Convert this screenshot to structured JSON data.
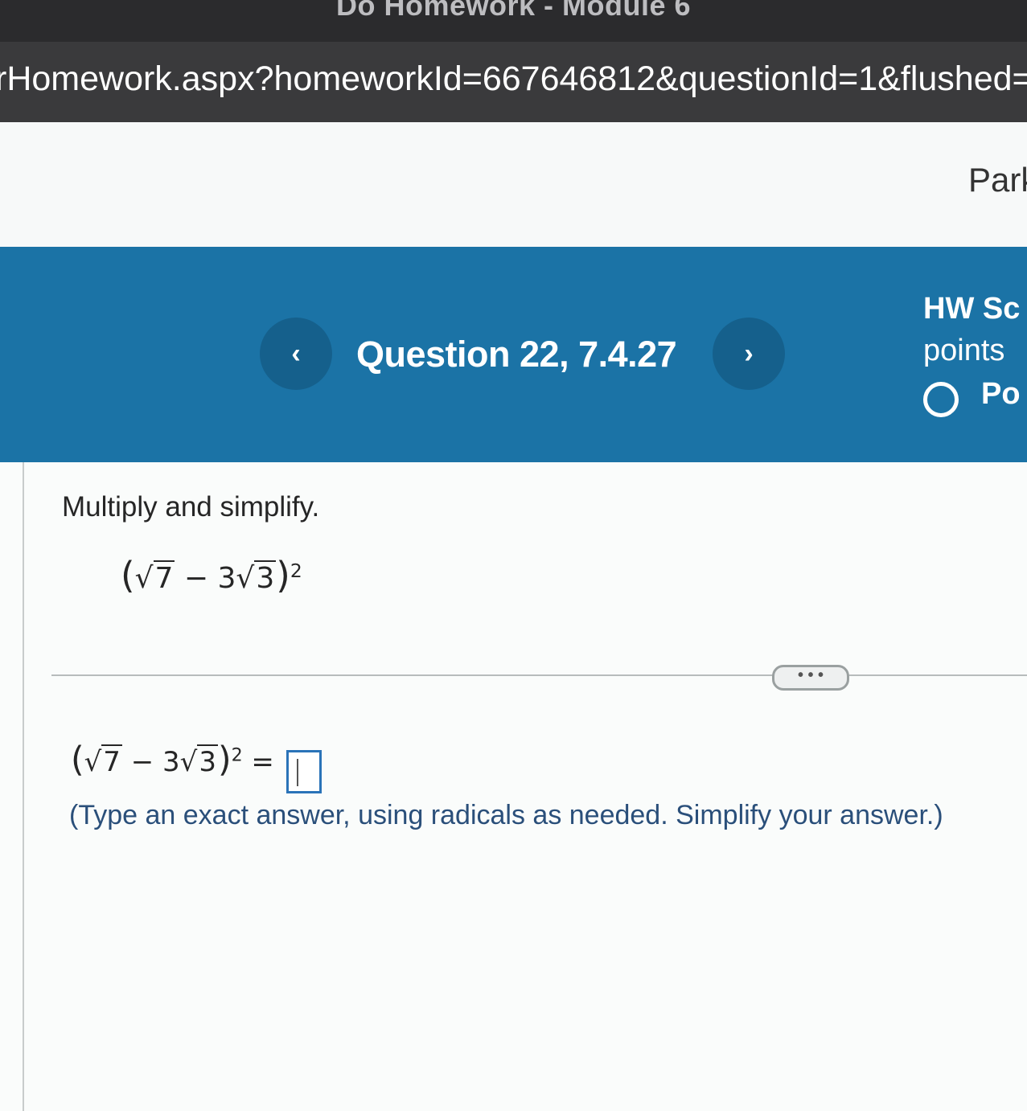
{
  "window": {
    "title": "Do Homework - Module 6"
  },
  "address_bar": {
    "url": "rHomework.aspx?homeworkId=667646812&questionId=1&flushed="
  },
  "header": {
    "account_link": "Park"
  },
  "question_nav": {
    "prev_label": "‹",
    "next_label": "›",
    "title": "Question 22, 7.4.27"
  },
  "score_panel": {
    "heading": "HW Sc",
    "points_label": "points",
    "status": "Po"
  },
  "problem": {
    "instruction": "Multiply and simplify.",
    "expression": {
      "open": "(",
      "radicand1": "7",
      "operator": " − 3",
      "radicand2": "3",
      "close": ")",
      "exponent": "2"
    }
  },
  "more_button": {
    "label": "• • •"
  },
  "answer": {
    "equals": " = ",
    "value": "",
    "hint": "(Type an exact answer, using radicals as needed. Simplify your answer.)"
  }
}
